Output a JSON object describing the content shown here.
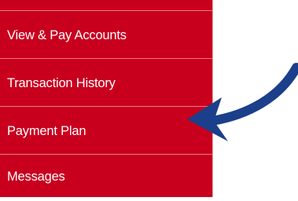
{
  "sidebar": {
    "background_color": "#c8001e",
    "items": [
      {
        "label": "View & Pay Accounts"
      },
      {
        "label": "Transaction History"
      },
      {
        "label": "Payment Plan"
      },
      {
        "label": "Messages"
      }
    ]
  },
  "annotation": {
    "icon": "curved-arrow-icon",
    "color": "#1b3f8a",
    "points_to": "Payment Plan"
  }
}
